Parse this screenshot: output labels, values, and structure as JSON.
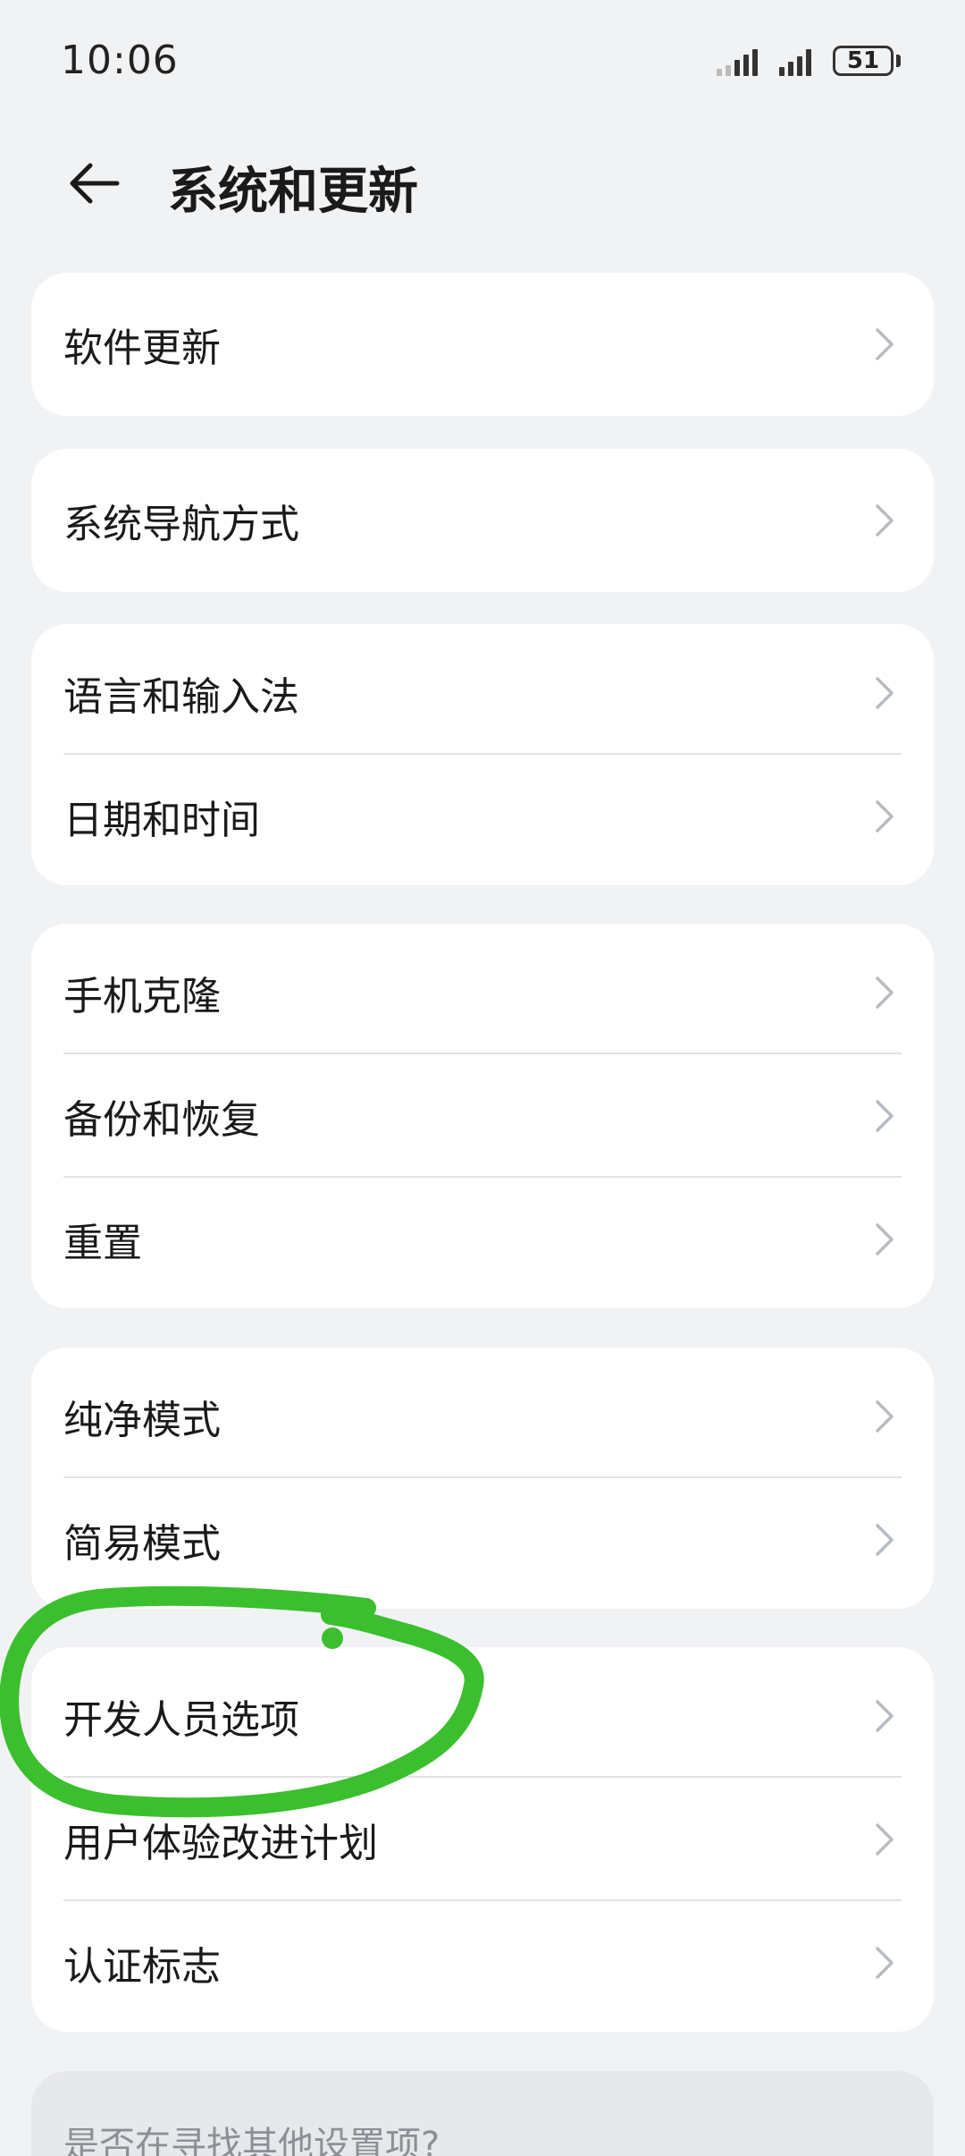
{
  "status_bar": {
    "time": "10:06",
    "battery": "51"
  },
  "header": {
    "title": "系统和更新"
  },
  "groups": [
    {
      "items": [
        {
          "label": "软件更新"
        }
      ]
    },
    {
      "items": [
        {
          "label": "系统导航方式"
        }
      ]
    },
    {
      "items": [
        {
          "label": "语言和输入法"
        },
        {
          "label": "日期和时间"
        }
      ]
    },
    {
      "items": [
        {
          "label": "手机克隆"
        },
        {
          "label": "备份和恢复"
        },
        {
          "label": "重置"
        }
      ]
    },
    {
      "items": [
        {
          "label": "纯净模式"
        },
        {
          "label": "简易模式"
        }
      ]
    },
    {
      "items": [
        {
          "label": "开发人员选项"
        },
        {
          "label": "用户体验改进计划"
        },
        {
          "label": "认证标志"
        }
      ]
    }
  ],
  "search_prompt": "是否在寻找其他设置项?",
  "colors": {
    "background": "#f1f2f4",
    "card": "#ffffff",
    "annotation": "#3bbf2e"
  }
}
